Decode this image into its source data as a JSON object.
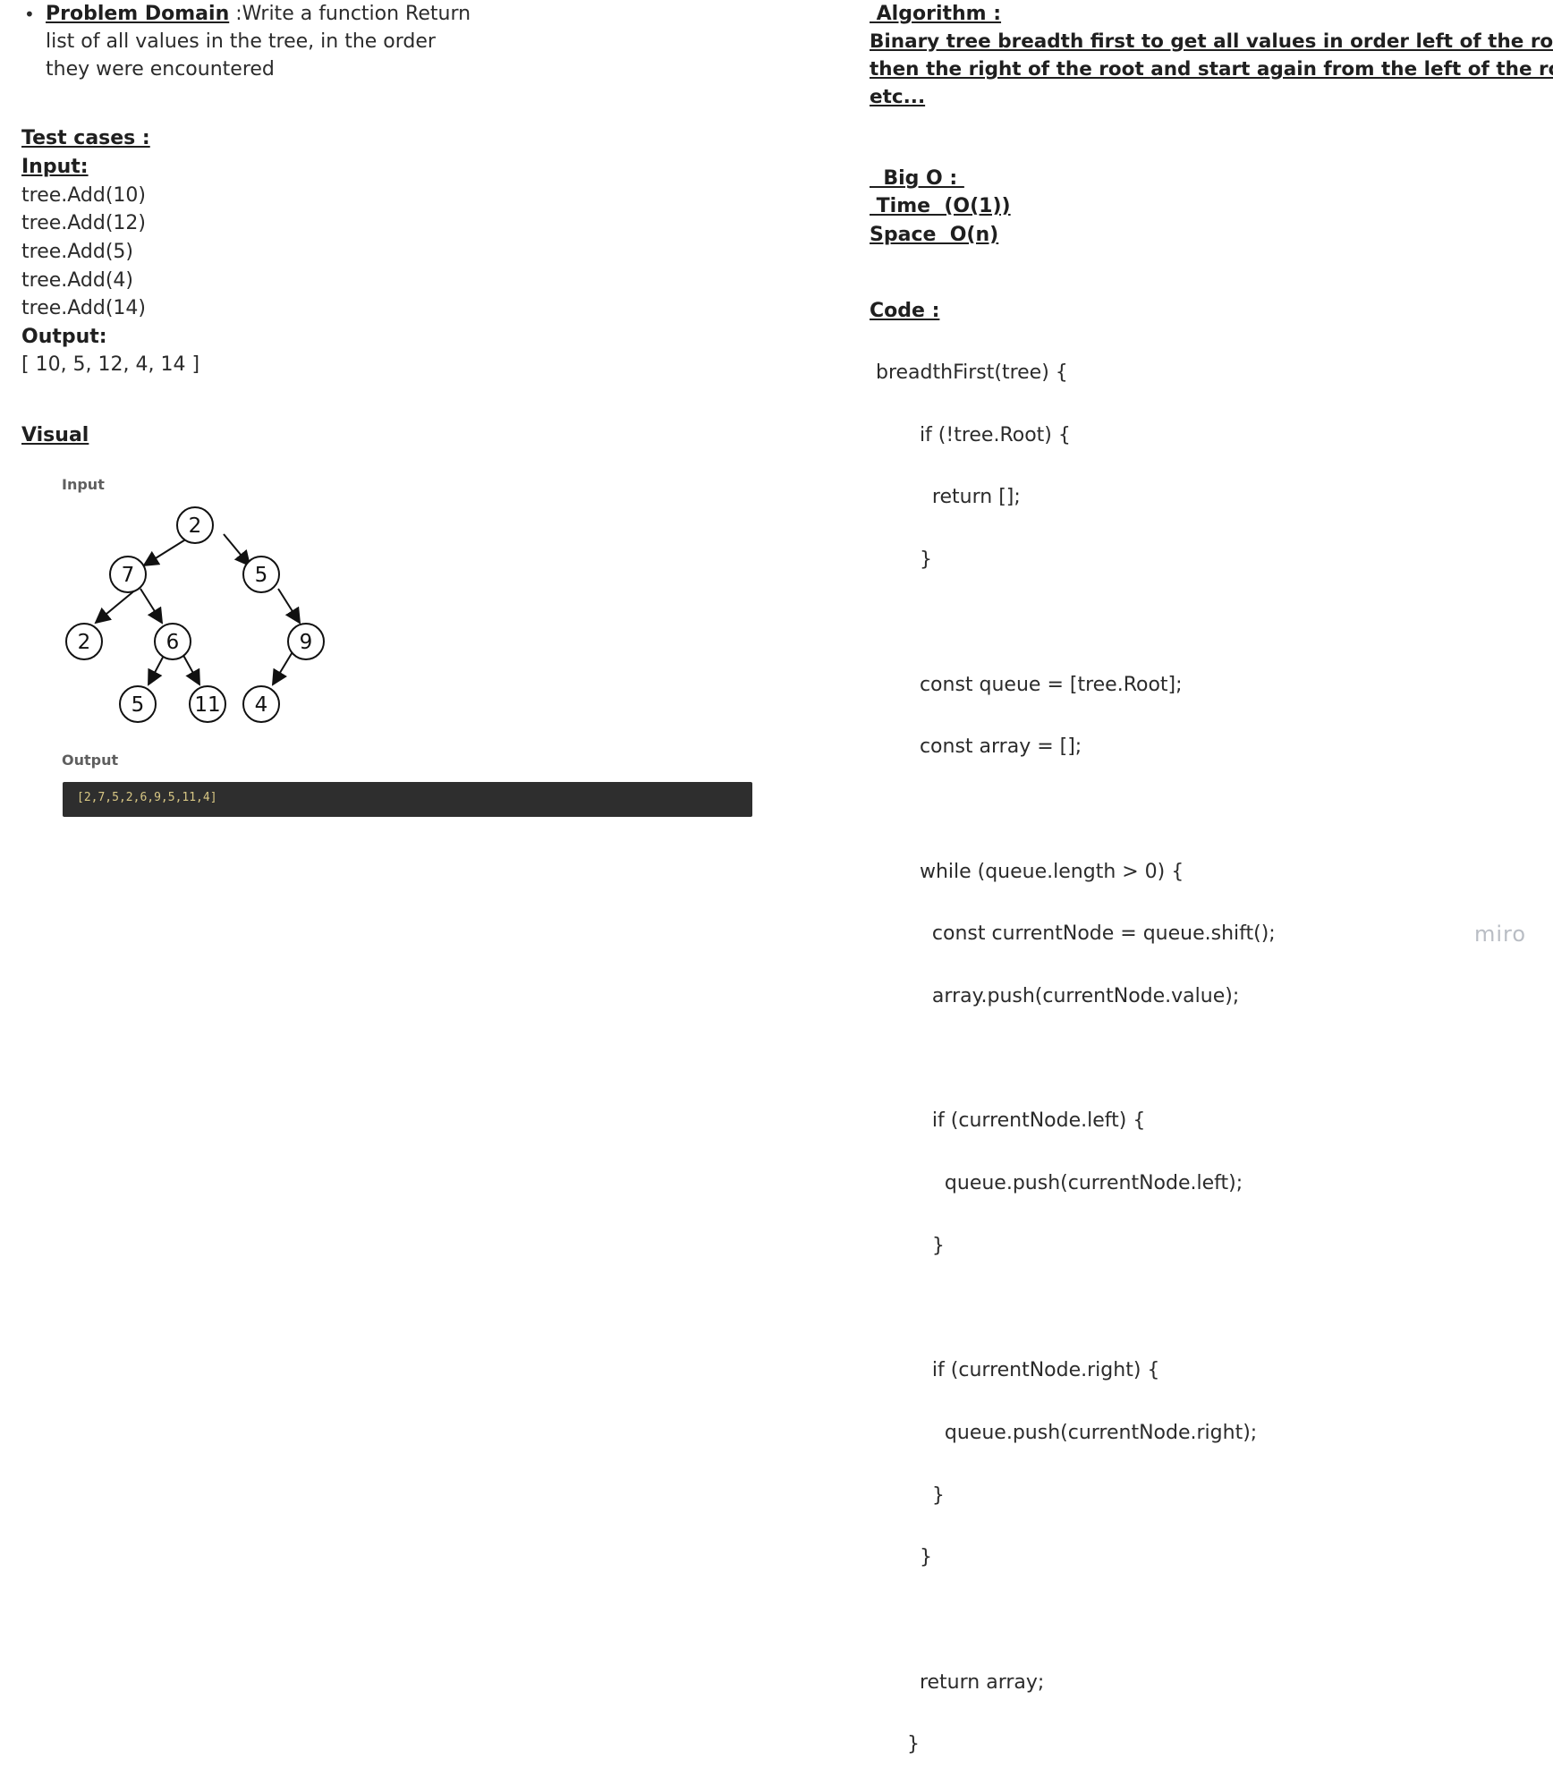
{
  "problem": {
    "bullet": "•",
    "heading": "Problem Domain",
    "line1": " :Write a function Return",
    "line2": "list of all values in the tree, in the order",
    "line3": "they were encountered"
  },
  "tests": {
    "heading": "Test cases :",
    "input_heading": "Input:",
    "inputs": [
      "tree.Add(10)",
      "tree.Add(12)",
      "tree.Add(5)",
      "tree.Add(4)",
      "tree.Add(14)"
    ],
    "output_heading": "Output:",
    "output_value": "[ 10, 5, 12, 4, 14 ]"
  },
  "visual": {
    "heading": "Visual",
    "input_label": "Input",
    "output_label": "Output",
    "output_text": "[2,7,5,2,6,9,5,11,4]",
    "tree_nodes": [
      "2",
      "7",
      "5",
      "2",
      "6",
      "9",
      "5",
      "11",
      "4"
    ]
  },
  "algorithm": {
    "heading": " Algorithm :",
    "line1": "Binary tree breadth first to get all values in order left of the root and",
    "line2": "then the right of the root and start again from the left of the root ",
    "line3": "etc..."
  },
  "bigo": {
    "heading": "  Big O : ",
    "time": " Time  (O(1))",
    "space": "Space  O(n)"
  },
  "code": {
    "heading": "Code :",
    "lines": [
      " breadthFirst(tree) {",
      "        if (!tree.Root) {",
      "          return [];",
      "        }",
      "",
      "        const queue = [tree.Root];",
      "        const array = [];",
      "",
      "        while (queue.length > 0) {",
      "          const currentNode = queue.shift();",
      "          array.push(currentNode.value);",
      "",
      "          if (currentNode.left) {",
      "            queue.push(currentNode.left);",
      "          }",
      "",
      "          if (currentNode.right) {",
      "            queue.push(currentNode.right);",
      "          }",
      "        }",
      "",
      "        return array;",
      "      }"
    ]
  },
  "watermark": "miro"
}
